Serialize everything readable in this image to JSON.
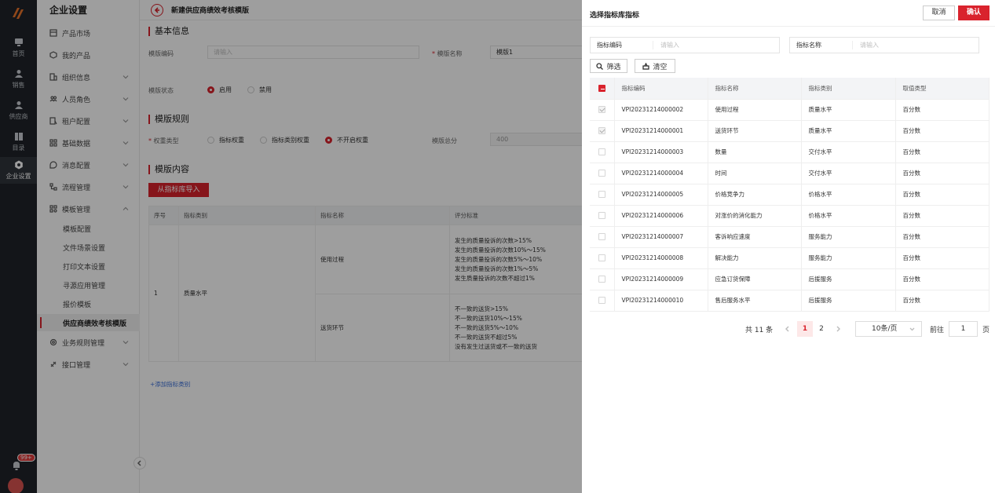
{
  "rail": {
    "items": [
      {
        "label": "首页",
        "icon": "monitor-icon"
      },
      {
        "label": "销售",
        "icon": "user-icon"
      },
      {
        "label": "供应商",
        "icon": "user-icon"
      },
      {
        "label": "目录",
        "icon": "book-icon"
      },
      {
        "label": "企业设置",
        "icon": "gear-icon"
      }
    ],
    "badge": "99+"
  },
  "menu": {
    "title": "企业设置",
    "items": [
      {
        "label": "产品市场"
      },
      {
        "label": "我的产品"
      },
      {
        "label": "组织信息"
      },
      {
        "label": "人员角色"
      },
      {
        "label": "租户配置"
      },
      {
        "label": "基础数据"
      },
      {
        "label": "消息配置"
      },
      {
        "label": "流程管理"
      },
      {
        "label": "模板管理"
      }
    ],
    "sub_items": [
      {
        "label": "模板配置"
      },
      {
        "label": "文件场景设置"
      },
      {
        "label": "打印文本设置"
      },
      {
        "label": "寻源应用管理"
      },
      {
        "label": "报价模板"
      },
      {
        "label": "供应商绩效考核模版"
      }
    ],
    "bottom_items": [
      {
        "label": "业务规则管理"
      },
      {
        "label": "接口管理"
      }
    ]
  },
  "page": {
    "title": "新建供应商绩效考核模版",
    "basic_section": "基本信息",
    "code_label": "模版编码",
    "code_placeholder": "请输入",
    "name_label": "模版名称",
    "name_value": "模版1",
    "status_label": "模版状态",
    "status_on": "启用",
    "status_off": "禁用",
    "rules_section": "模版规则",
    "weight_label": "权重类型",
    "weight_opt1": "指标权重",
    "weight_opt2": "指标类别权重",
    "weight_opt3": "不开启权重",
    "total_label": "模版总分",
    "total_value": "400",
    "content_section": "模版内容",
    "import_button": "从指标库导入",
    "add_category": "+添加指标类别",
    "table": {
      "headers": [
        "序号",
        "指标类别",
        "指标名称",
        "评分标准"
      ],
      "seq": "1",
      "category": "质量水平",
      "rows": [
        {
          "name": "使用过程",
          "criteria": [
            "发生的质量投诉的次数>15%",
            "发生的质量投诉的次数10%～15%",
            "发生的质量投诉的次数5%～10%",
            "发生的质量投诉的次数1%～5%",
            "发生质量投诉的次数不超过1%"
          ]
        },
        {
          "name": "送货环节",
          "criteria": [
            "不一致的送货>15%",
            "不一致的送货10%～15%",
            "不一致的送货5%～10%",
            "不一致的送货不超过5%",
            "没有发生过送货或不一致的送货"
          ]
        }
      ]
    }
  },
  "drawer": {
    "title": "选择指标库指标",
    "cancel": "取消",
    "confirm": "确认",
    "filter_code_label": "指标编码",
    "filter_code_placeholder": "请输入",
    "filter_name_label": "指标名称",
    "filter_name_placeholder": "请输入",
    "search_button": "筛选",
    "clear_button": "清空",
    "headers": [
      "指标编码",
      "指标名称",
      "指标类别",
      "取值类型"
    ],
    "rows": [
      {
        "code": "VPI20231214000002",
        "name": "使用过程",
        "category": "质量水平",
        "type": "百分数",
        "checked": true
      },
      {
        "code": "VPI20231214000001",
        "name": "送货环节",
        "category": "质量水平",
        "type": "百分数",
        "checked": true
      },
      {
        "code": "VPI20231214000003",
        "name": "数量",
        "category": "交付水平",
        "type": "百分数",
        "checked": false
      },
      {
        "code": "VPI20231214000004",
        "name": "时间",
        "category": "交付水平",
        "type": "百分数",
        "checked": false
      },
      {
        "code": "VPI20231214000005",
        "name": "价格竞争力",
        "category": "价格水平",
        "type": "百分数",
        "checked": false
      },
      {
        "code": "VPI20231214000006",
        "name": "对涨价的消化能力",
        "category": "价格水平",
        "type": "百分数",
        "checked": false
      },
      {
        "code": "VPI20231214000007",
        "name": "客诉响应速度",
        "category": "服务能力",
        "type": "百分数",
        "checked": false
      },
      {
        "code": "VPI20231214000008",
        "name": "解决能力",
        "category": "服务能力",
        "type": "百分数",
        "checked": false
      },
      {
        "code": "VPI20231214000009",
        "name": "应急订货保障",
        "category": "后援服务",
        "type": "百分数",
        "checked": false
      },
      {
        "code": "VPI20231214000010",
        "name": "售后服务水平",
        "category": "后援服务",
        "type": "百分数",
        "checked": false
      }
    ],
    "pager": {
      "total": "共 11 条",
      "page1": "1",
      "page2": "2",
      "page_size": "10条/页",
      "goto_label": "前往",
      "goto_value": "1",
      "page_suffix": "页"
    }
  },
  "colors": {
    "accent": "#d9232d",
    "rail": "#1f2329"
  }
}
